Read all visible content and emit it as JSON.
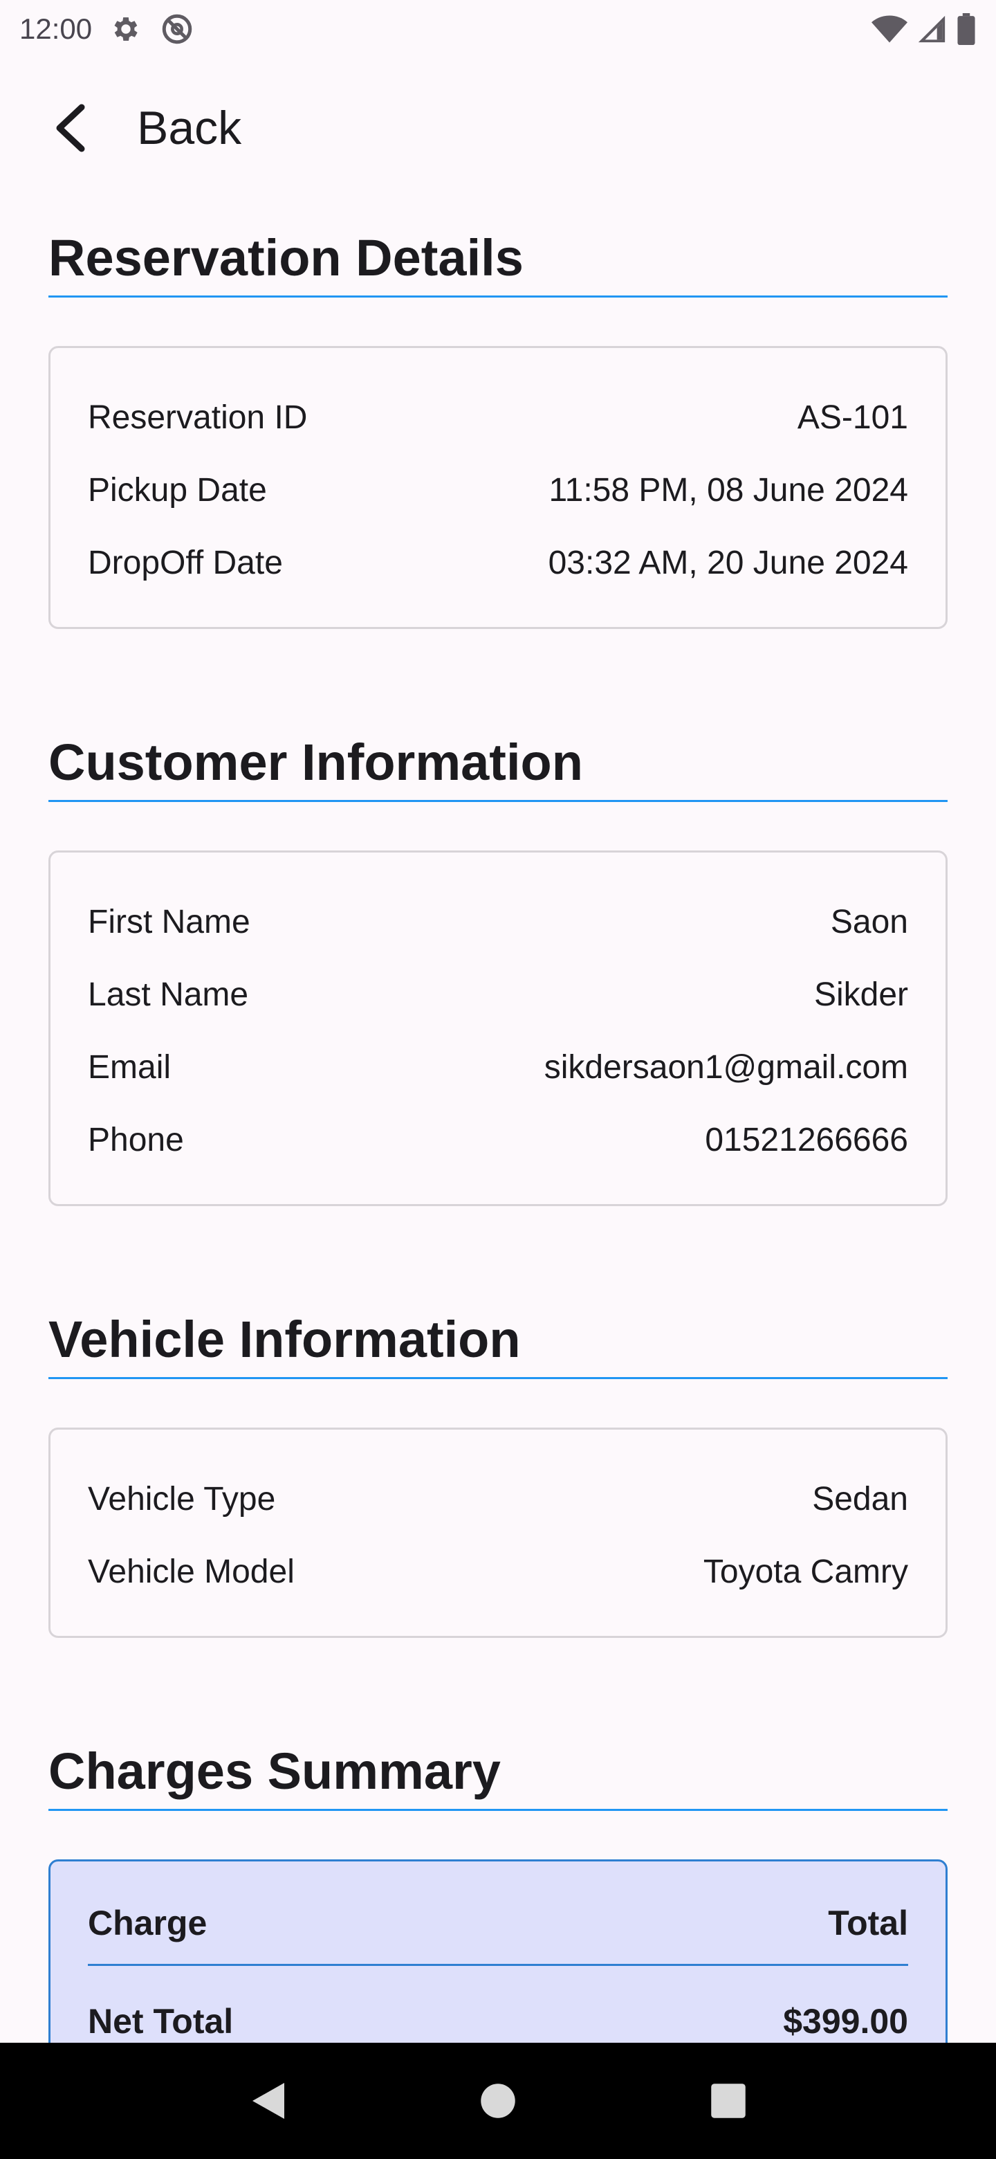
{
  "status_bar": {
    "time": "12:00",
    "icons": [
      "gear-icon",
      "no-disturb-icon",
      "wifi-icon",
      "signal-icon",
      "battery-icon"
    ]
  },
  "app_bar": {
    "back_label": "Back",
    "back_icon": "chevron-left-icon"
  },
  "reservation": {
    "title": "Reservation Details",
    "rows": [
      {
        "label": "Reservation ID",
        "value": "AS-101"
      },
      {
        "label": "Pickup Date",
        "value": "11:58 PM, 08 June 2024"
      },
      {
        "label": "DropOff Date",
        "value": "03:32 AM, 20 June 2024"
      }
    ]
  },
  "customer": {
    "title": "Customer Information",
    "rows": [
      {
        "label": "First Name",
        "value": "Saon"
      },
      {
        "label": "Last Name",
        "value": "Sikder"
      },
      {
        "label": "Email",
        "value": "sikdersaon1@gmail.com"
      },
      {
        "label": "Phone",
        "value": "01521266666"
      }
    ]
  },
  "vehicle": {
    "title": "Vehicle Information",
    "rows": [
      {
        "label": "Vehicle Type",
        "value": "Sedan"
      },
      {
        "label": "Vehicle Model",
        "value": "Toyota Camry"
      }
    ]
  },
  "charges": {
    "title": "Charges Summary",
    "header_charge": "Charge",
    "header_total": "Total",
    "net_total_label": "Net Total",
    "net_total_value": "$399.00"
  },
  "nav": {
    "icons": [
      "nav-back-icon",
      "nav-home-icon",
      "nav-recents-icon"
    ]
  },
  "colors": {
    "accent": "#2196f3",
    "charges_background": "#dee0fb",
    "page_background": "#fdf9fc"
  }
}
